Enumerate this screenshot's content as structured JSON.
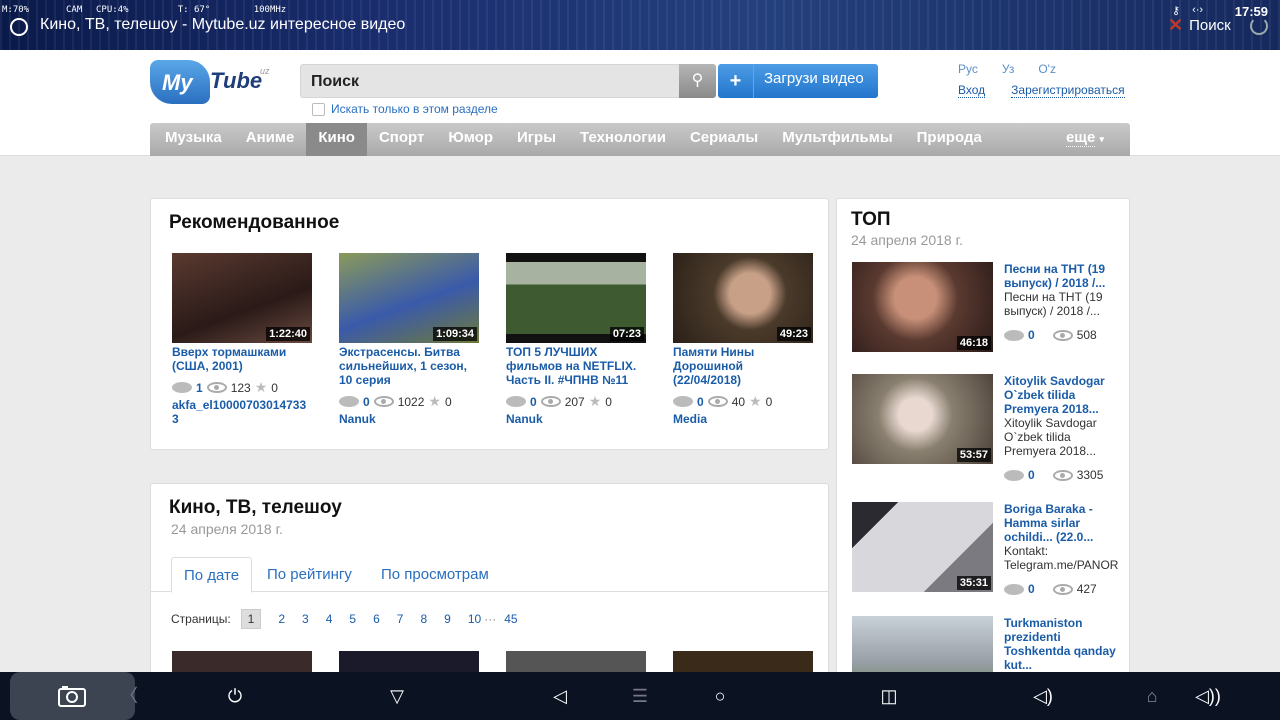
{
  "status_bar": {
    "metrics": {
      "mem": "M:70%",
      "cpu_label": "CPU:",
      "cpu_value": "4%",
      "temp": "T: 67°",
      "freq": "100MHz",
      "cam": "CAM"
    },
    "window_title": "Кино, ТВ, телешоу - Mytube.uz интересное видео",
    "search_label": "Поиск",
    "time": "17:59"
  },
  "header": {
    "logo": {
      "my": "My",
      "tube": "Tube",
      "uz": "uz"
    },
    "search_value": "Поиск",
    "upload_label": "Загрузи видео",
    "section_only_label": "Искать только в этом разделе",
    "languages": [
      "Рус",
      "Уз",
      "O'z"
    ],
    "login": "Вход",
    "register": "Зарегистрироваться"
  },
  "nav": {
    "items": [
      "Музыка",
      "Аниме",
      "Кино",
      "Спорт",
      "Юмор",
      "Игры",
      "Технологии",
      "Сериалы",
      "Мультфильмы",
      "Природа"
    ],
    "active_index": 2,
    "more": "еще"
  },
  "recommended": {
    "title": "Рекомендованное",
    "videos": [
      {
        "title": "Вверх тормашками (США, 2001)",
        "duration": "1:22:40",
        "comments": "1",
        "views": "123",
        "rating": "0",
        "author": "akfa_el10000703014733 3",
        "thumb_color": "#2a1a18"
      },
      {
        "title": "Экстрасенсы. Битва сильнейших, 1 сезон, 10 серия",
        "duration": "1:09:34",
        "comments": "0",
        "views": "1022",
        "rating": "0",
        "author": "Nanuk",
        "thumb_color": "#6e7a3a"
      },
      {
        "title": "ТОП 5 ЛУЧШИХ фильмов на NETFLIX. Часть II. #ЧПНВ №11",
        "duration": "07:23",
        "comments": "0",
        "views": "207",
        "rating": "0",
        "author": "Nanuk",
        "thumb_color": "#3d5a30"
      },
      {
        "title": "Памяти Нины Дорошиной (22/04/2018)",
        "duration": "49:23",
        "comments": "0",
        "views": "40",
        "rating": "0",
        "author": "Media",
        "thumb_color": "#4a3a2a"
      }
    ]
  },
  "kino": {
    "title": "Кино, ТВ, телешоу",
    "date": "24 апреля 2018 г.",
    "tabs": [
      "По дате",
      "По рейтингу",
      "По просмотрам"
    ],
    "pages_label": "Страницы:",
    "pages": [
      "1",
      "2",
      "3",
      "4",
      "5",
      "6",
      "7",
      "8",
      "9",
      "10"
    ],
    "ellipsis": "···",
    "last_page": "45",
    "thumb_colors": [
      "#3a2a2a",
      "#1a1a2a",
      "#555555",
      "#3a2a1a"
    ]
  },
  "top": {
    "title": "ТОП",
    "date": "24 апреля 2018 г.",
    "items": [
      {
        "title": "Песни на ТНТ (19 выпуск) / 2018 /...",
        "desc": "Песни на ТНТ (19 выпуск) / 2018 /...",
        "duration": "46:18",
        "comments": "0",
        "views": "508",
        "thumb_color": "#5a3a30"
      },
      {
        "title": "Xitoylik Savdogar O`zbek tilida Premyera 2018...",
        "desc": "Xitoylik Savdogar O`zbek tilida Premyera 2018...",
        "duration": "53:57",
        "comments": "0",
        "views": "3305",
        "thumb_color": "#8a8070"
      },
      {
        "title": "Boriga Baraka - Hamma sirlar ochildi... (22.0...",
        "desc": "Kontakt: Telegram.me/PANOR",
        "duration": "35:31",
        "comments": "0",
        "views": "427",
        "thumb_color": "#7a7a80"
      },
      {
        "title": "Turkmaniston prezidenti Toshkentda qanday kut...",
        "desc": "",
        "duration": "",
        "comments": "",
        "views": "",
        "thumb_color": "#9aa0a8"
      }
    ]
  },
  "navbar": {
    "icons": [
      "screenshot-icon",
      "back-chevron-icon",
      "power-icon",
      "down-triangle-icon",
      "back-icon",
      "menu-icon",
      "home-icon",
      "recents-icon",
      "volume-down-icon",
      "house-icon",
      "volume-up-icon"
    ]
  }
}
